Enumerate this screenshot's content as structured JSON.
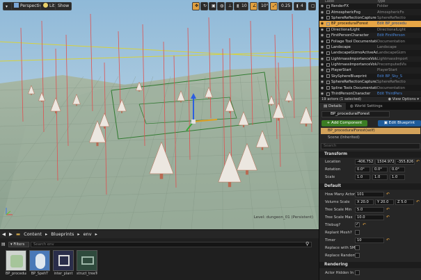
{
  "viewport": {
    "perspective_label": "Perspective",
    "lit_label": "Lit",
    "show_label": "Show",
    "grid_value": "10",
    "rot_value": "10°",
    "scale_value": "0.25",
    "cam_value": "4",
    "level_caption": "Level: dungeon_01 (Persistent)"
  },
  "outliner": {
    "columns": [
      "Label",
      "Type"
    ],
    "rows": [
      {
        "label": "RenderFX",
        "type": "Folder",
        "link": false
      },
      {
        "label": "AtmosphericFog",
        "type": "AtmosphericFo",
        "link": false
      },
      {
        "label": "SphereReflectionCapture",
        "type": "SphereReflectio",
        "link": false
      },
      {
        "label": "BP_proceduralForest",
        "type": "Edit BP_procedu",
        "link": true,
        "selected": true
      },
      {
        "label": "DirectionalLight",
        "type": "DirectionalLight",
        "link": false
      },
      {
        "label": "FirstPersonCharacter",
        "type": "Edit FirstPerson",
        "link": true
      },
      {
        "label": "Foliage Tool Documentation",
        "type": "Documentation",
        "link": false
      },
      {
        "label": "Landscape",
        "type": "Landscape",
        "link": false
      },
      {
        "label": "LandscapeGizmoActiveActor",
        "type": "LandscapeGizm",
        "link": false
      },
      {
        "label": "LightmassImportanceVolume",
        "type": "LightmassImport",
        "link": false
      },
      {
        "label": "LightmassImportanceVolume",
        "type": "PrecomputedVis",
        "link": false
      },
      {
        "label": "PlayerStart",
        "type": "PlayerStart",
        "link": false
      },
      {
        "label": "SkySphereBlueprint",
        "type": "Edit BP_Sky_S",
        "link": true
      },
      {
        "label": "SphereReflectionCapture3",
        "type": "SphereReflectio",
        "link": false
      },
      {
        "label": "Spline Tools Documentation",
        "type": "Documentation",
        "link": false
      },
      {
        "label": "ThirdPersonCharacter",
        "type": "Edit ThirdPers",
        "link": true
      }
    ],
    "footer_count": "19 actors (1 selected)",
    "footer_view": "View Options"
  },
  "details": {
    "tab_details": "Details",
    "tab_world": "World Settings",
    "actor_name": "BP_proceduralForest",
    "add_component": "+ Add Component",
    "edit_blueprint": "Edit Blueprint",
    "self_component": "BP_proceduralForest(self)",
    "scene_component": "Scene (Inherited)",
    "search_placeholder": "Search",
    "transform_section": "Transform",
    "location_label": "Location",
    "location": [
      "-406.752",
      "1504.972",
      "-355.826"
    ],
    "rotation_label": "Rotation",
    "rotation": [
      "0.0°",
      "0.0°",
      "0.0°"
    ],
    "scale_label": "Scale",
    "scale": [
      "1.0",
      "1.0",
      "1.0"
    ],
    "default_section": "Default",
    "actors_label": "How Many Actors",
    "actors_value": "101",
    "volume_label": "Volume Scale",
    "volume": [
      "X 20.0",
      "Y 20.0",
      "Z 5.0"
    ],
    "tree_min_label": "Tree Scale Min",
    "tree_min_value": "5.0",
    "tree_max_label": "Tree Scale Max",
    "tree_max_value": "10.0",
    "tilebug_label": "Tilebug?",
    "replant_label": "Replant Mesh?",
    "timer_label": "Timer",
    "timer_value": "10",
    "replace_smt_label": "Replace with SMT",
    "replace_random_label": "Replace Random?",
    "rendering_section": "Rendering",
    "hidden_label": "Actor Hidden In Ga"
  },
  "content_browser": {
    "path": [
      "Content",
      "Blueprints",
      "env"
    ],
    "filters_label": "Filters",
    "search_placeholder": "Search env",
    "assets": [
      {
        "label": "BP_procedural"
      },
      {
        "label": "BP_SpehT"
      },
      {
        "label": "inter_plant"
      },
      {
        "label": "struct_treeTo"
      }
    ]
  }
}
